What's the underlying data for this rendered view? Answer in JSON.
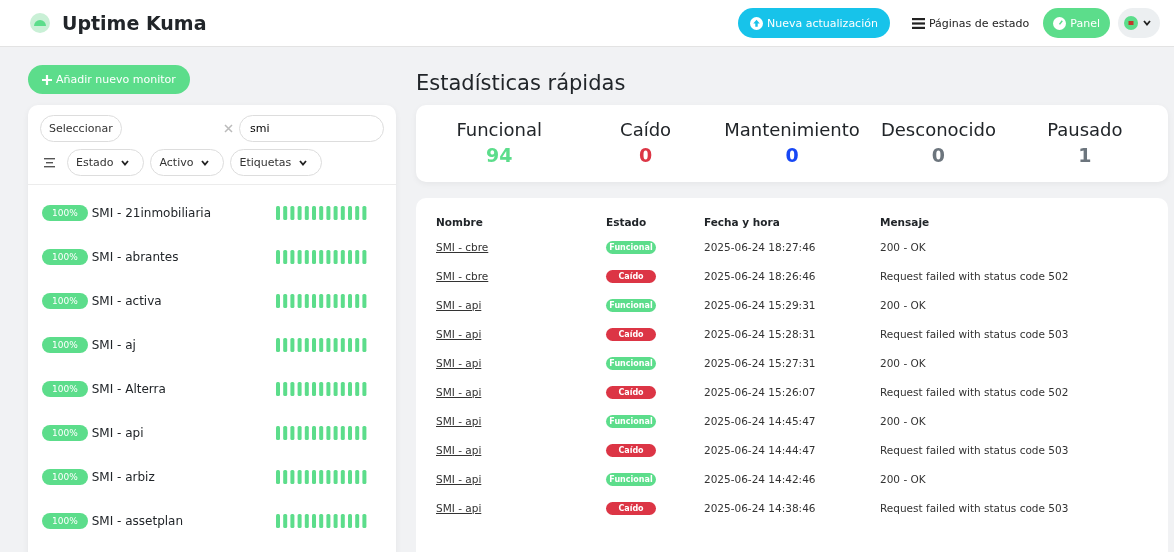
{
  "header": {
    "title": "Uptime Kuma",
    "update_button": "Nueva actualización",
    "status_pages_link": "Páginas de estado",
    "dashboard_button": "Panel"
  },
  "sidebar": {
    "add_button": "Añadir nuevo monitor",
    "select_button": "Seleccionar",
    "search": {
      "value": "smi"
    },
    "filters": [
      "Estado",
      "Activo",
      "Etiquetas"
    ],
    "monitors": [
      {
        "uptime": "100%",
        "name": "SMI - 21inmobiliaria"
      },
      {
        "uptime": "100%",
        "name": "SMI - abrantes"
      },
      {
        "uptime": "100%",
        "name": "SMI - activa"
      },
      {
        "uptime": "100%",
        "name": "SMI - aj"
      },
      {
        "uptime": "100%",
        "name": "SMI - Alterra"
      },
      {
        "uptime": "100%",
        "name": "SMI - api"
      },
      {
        "uptime": "100%",
        "name": "SMI - arbiz"
      },
      {
        "uptime": "100%",
        "name": "SMI - assetplan"
      }
    ]
  },
  "stats": {
    "title": "Estadísticas rápidas",
    "items": [
      {
        "label": "Funcional",
        "value": "94",
        "color": "#5cdd8b"
      },
      {
        "label": "Caído",
        "value": "0",
        "color": "#dc3545"
      },
      {
        "label": "Mantenimiento",
        "value": "0",
        "color": "#1747f5"
      },
      {
        "label": "Desconocido",
        "value": "0",
        "color": "#6c757d"
      },
      {
        "label": "Pausado",
        "value": "1",
        "color": "#6c757d"
      }
    ]
  },
  "events": {
    "columns": [
      "Nombre",
      "Estado",
      "Fecha y hora",
      "Mensaje"
    ],
    "rows": [
      {
        "name": "SMI - cbre",
        "kind": "up",
        "status": "Funcional",
        "time": "2025-06-24 18:27:46",
        "message": "200 - OK"
      },
      {
        "name": "SMI - cbre",
        "kind": "down",
        "status": "Caído",
        "time": "2025-06-24 18:26:46",
        "message": "Request failed with status code 502"
      },
      {
        "name": "SMI - api",
        "kind": "up",
        "status": "Funcional",
        "time": "2025-06-24 15:29:31",
        "message": "200 - OK"
      },
      {
        "name": "SMI - api",
        "kind": "down",
        "status": "Caído",
        "time": "2025-06-24 15:28:31",
        "message": "Request failed with status code 503"
      },
      {
        "name": "SMI - api",
        "kind": "up",
        "status": "Funcional",
        "time": "2025-06-24 15:27:31",
        "message": "200 - OK"
      },
      {
        "name": "SMI - api",
        "kind": "down",
        "status": "Caído",
        "time": "2025-06-24 15:26:07",
        "message": "Request failed with status code 502"
      },
      {
        "name": "SMI - api",
        "kind": "up",
        "status": "Funcional",
        "time": "2025-06-24 14:45:47",
        "message": "200 - OK"
      },
      {
        "name": "SMI - api",
        "kind": "down",
        "status": "Caído",
        "time": "2025-06-24 14:44:47",
        "message": "Request failed with status code 503"
      },
      {
        "name": "SMI - api",
        "kind": "up",
        "status": "Funcional",
        "time": "2025-06-24 14:42:46",
        "message": "200 - OK"
      },
      {
        "name": "SMI - api",
        "kind": "down",
        "status": "Caído",
        "time": "2025-06-24 14:38:46",
        "message": "Request failed with status code 503"
      }
    ]
  }
}
